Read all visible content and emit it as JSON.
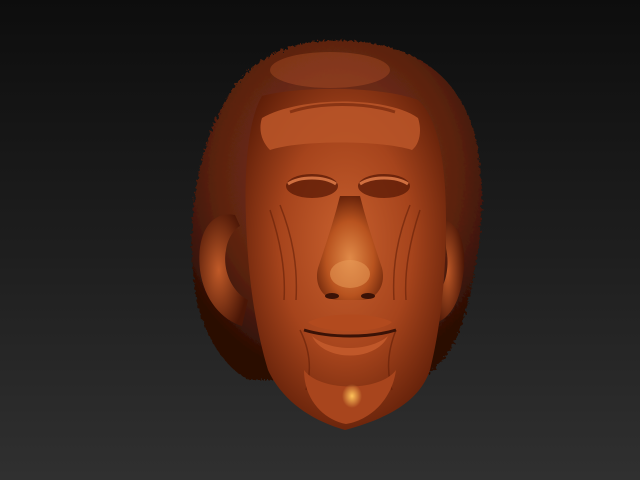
{
  "scene": {
    "subject": "sculpted-head",
    "background_top": "#0d0d0d",
    "background_bottom": "#303030",
    "material_color": "#b34a22",
    "highlight_color": "#e08a48",
    "shadow_color": "#3a1206"
  }
}
